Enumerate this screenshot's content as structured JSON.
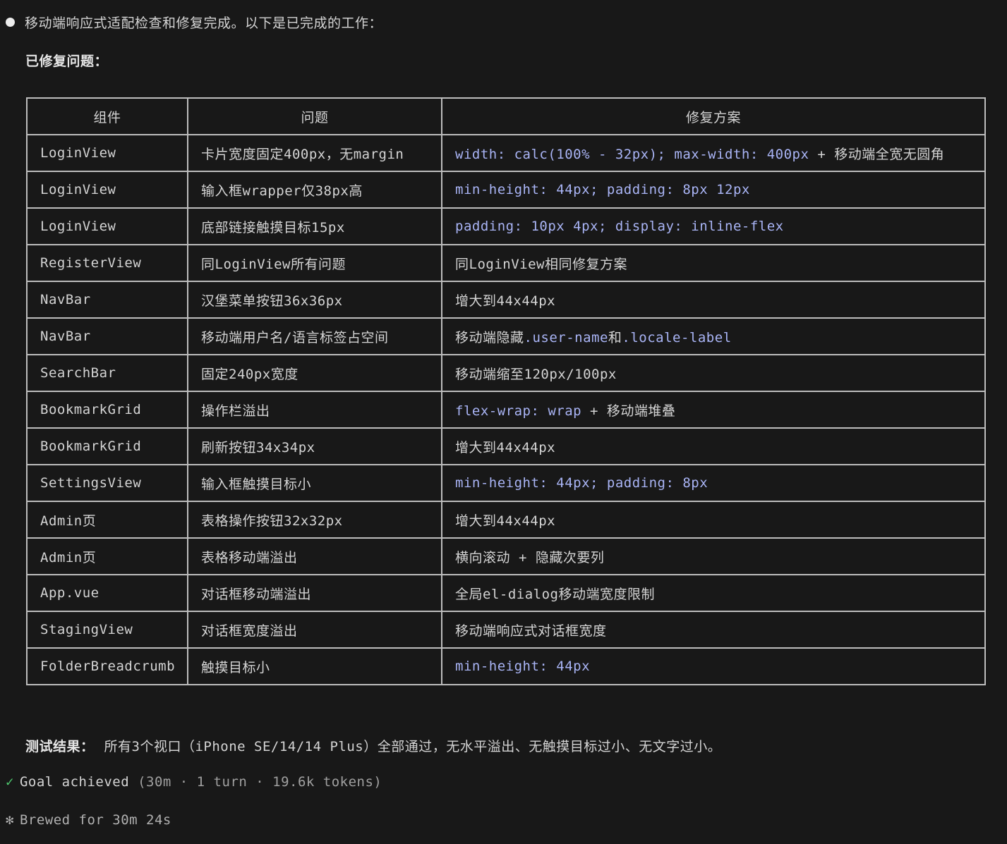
{
  "summary": "移动端响应式适配检查和修复完成。以下是已完成的工作：",
  "fixed_heading": "已修复问题：",
  "table": {
    "headers": [
      "组件",
      "问题",
      "修复方案"
    ],
    "rows": [
      {
        "component": "LoginView",
        "issue": "卡片宽度固定400px，无margin",
        "fix": [
          {
            "text": "width: calc(100% - 32px); max-width: 400px",
            "code": true
          },
          {
            "text": " + 移动端全宽无圆角",
            "code": false
          }
        ]
      },
      {
        "component": "LoginView",
        "issue": "输入框wrapper仅38px高",
        "fix": [
          {
            "text": "min-height: 44px; padding: 8px 12px",
            "code": true
          }
        ]
      },
      {
        "component": "LoginView",
        "issue": "底部链接触摸目标15px",
        "fix": [
          {
            "text": "padding: 10px 4px; display: inline-flex",
            "code": true
          }
        ]
      },
      {
        "component": "RegisterView",
        "issue": "同LoginView所有问题",
        "fix": [
          {
            "text": "同LoginView相同修复方案",
            "code": false
          }
        ]
      },
      {
        "component": "NavBar",
        "issue": "汉堡菜单按钮36x36px",
        "fix": [
          {
            "text": "增大到44x44px",
            "code": false
          }
        ]
      },
      {
        "component": "NavBar",
        "issue": "移动端用户名/语言标签占空间",
        "fix": [
          {
            "text": "移动端隐藏",
            "code": false
          },
          {
            "text": ".user-name",
            "code": true
          },
          {
            "text": "和",
            "code": false
          },
          {
            "text": ".locale-label",
            "code": true
          }
        ]
      },
      {
        "component": "SearchBar",
        "issue": "固定240px宽度",
        "fix": [
          {
            "text": "移动端缩至120px/100px",
            "code": false
          }
        ]
      },
      {
        "component": "BookmarkGrid",
        "issue": "操作栏溢出",
        "fix": [
          {
            "text": "flex-wrap: wrap",
            "code": true
          },
          {
            "text": " + 移动端堆叠",
            "code": false
          }
        ]
      },
      {
        "component": "BookmarkGrid",
        "issue": "刷新按钮34x34px",
        "fix": [
          {
            "text": "增大到44x44px",
            "code": false
          }
        ]
      },
      {
        "component": "SettingsView",
        "issue": "输入框触摸目标小",
        "fix": [
          {
            "text": "min-height: 44px; padding: 8px",
            "code": true
          }
        ]
      },
      {
        "component": "Admin页",
        "issue": "表格操作按钮32x32px",
        "fix": [
          {
            "text": "增大到44x44px",
            "code": false
          }
        ]
      },
      {
        "component": "Admin页",
        "issue": "表格移动端溢出",
        "fix": [
          {
            "text": "横向滚动 + 隐藏次要列",
            "code": false
          }
        ]
      },
      {
        "component": "App.vue",
        "issue": "对话框移动端溢出",
        "fix": [
          {
            "text": "全局el-dialog移动端宽度限制",
            "code": false
          }
        ]
      },
      {
        "component": "StagingView",
        "issue": "对话框宽度溢出",
        "fix": [
          {
            "text": "移动端响应式对话框宽度",
            "code": false
          }
        ]
      },
      {
        "component": "FolderBreadcrumb",
        "issue": "触摸目标小",
        "fix": [
          {
            "text": "min-height: 44px",
            "code": true
          }
        ]
      }
    ]
  },
  "test_result": {
    "label": "测试结果：",
    "text": "所有3个视口（iPhone SE/14/14 Plus）全部通过，无水平溢出、无触摸目标过小、无文字过小。"
  },
  "status": {
    "check_icon": "✓",
    "goal": "Goal achieved",
    "detail": " (30m · 1 turn · 19.6k tokens)",
    "brew_icon": "✻",
    "brewed": "Brewed for 30m 24s"
  },
  "colors": {
    "background": "#181818",
    "text": "#d4d4d4",
    "code": "#a9b4f5",
    "success": "#4ec96e",
    "border": "#bdbdbd"
  }
}
